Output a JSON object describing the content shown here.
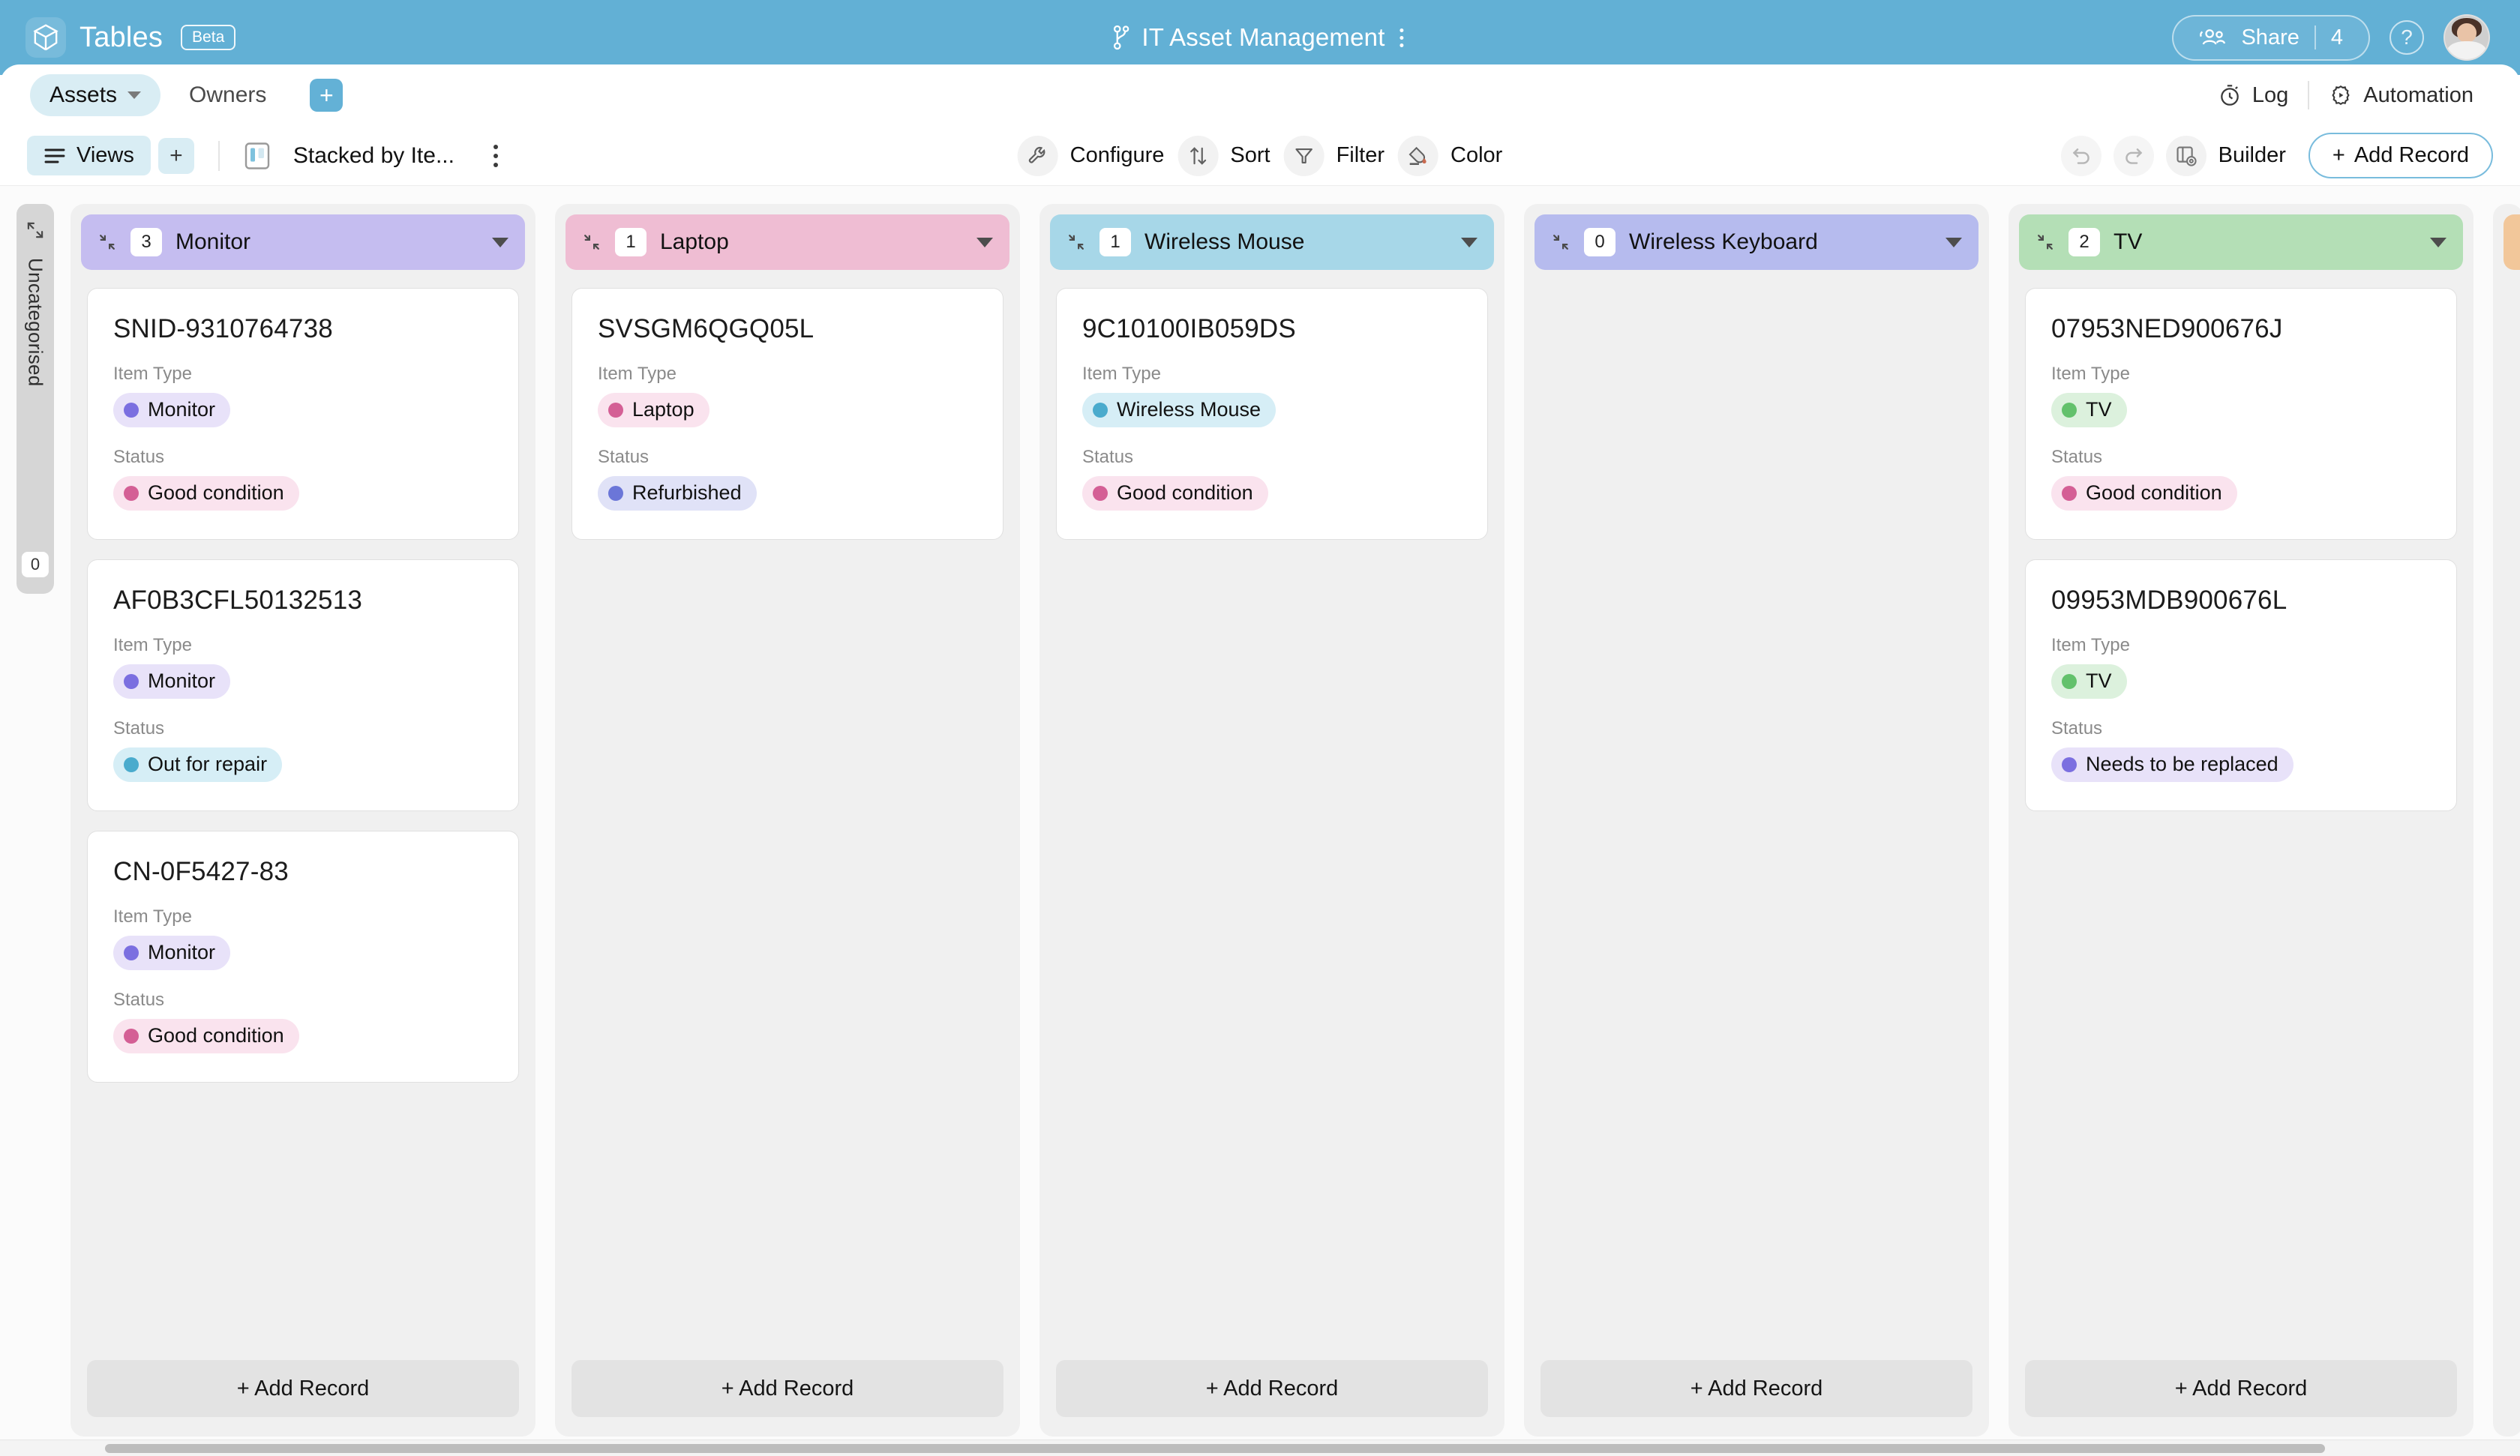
{
  "header": {
    "brand": "Tables",
    "badge": "Beta",
    "logo_icon": "cube-logo-icon",
    "doc_title": "IT Asset Management",
    "doc_icon": "branch-icon",
    "doc_menu_icon": "more-vertical-icon",
    "share_label": "Share",
    "share_count": "4",
    "share_icon": "people-icon",
    "help_icon": "help-circle-icon",
    "help_label": "?",
    "avatar_name": "user-avatar",
    "bg_color": "#62b0d5"
  },
  "tabbar": {
    "tabs": [
      {
        "label": "Assets",
        "active": true,
        "has_caret": true
      },
      {
        "label": "Owners",
        "active": false,
        "has_caret": false
      }
    ],
    "add_tab_label": "+",
    "right_items": [
      {
        "label": "Log",
        "icon": "stopwatch-icon"
      },
      {
        "label": "Automation",
        "icon": "gear-play-icon"
      }
    ]
  },
  "toolbar": {
    "views_label": "Views",
    "views_icon": "list-lines-icon",
    "add_view_label": "+",
    "view_icon": "kanban-board-icon",
    "view_name": "Stacked by Ite...",
    "view_menu_icon": "more-vertical-icon",
    "center_buttons": [
      {
        "label": "Configure",
        "icon": "wrench-icon"
      },
      {
        "label": "Sort",
        "icon": "sort-arrows-icon"
      },
      {
        "label": "Filter",
        "icon": "funnel-icon"
      },
      {
        "label": "Color",
        "icon": "paint-drop-icon"
      }
    ],
    "undo_icon": "undo-icon",
    "redo_icon": "redo-icon",
    "builder_label": "Builder",
    "builder_icon": "builder-panel-icon",
    "add_record_label": "Add Record"
  },
  "board": {
    "collapsed_column": {
      "label": "Uncategorised",
      "count": "0",
      "expand_icon": "expand-icon"
    },
    "add_record_label": "+ Add Record",
    "collapse_icon": "collapse-icon",
    "columns": [
      {
        "title": "Monitor",
        "count": "3",
        "header_color": "#c5bdf0",
        "cards": [
          {
            "title": "SNID-9310764738",
            "fields": [
              {
                "label": "Item Type",
                "value": "Monitor",
                "bg": "#e8e2f9",
                "dot": "#7b6fe0"
              },
              {
                "label": "Status",
                "value": "Good condition",
                "bg": "#fae3ee",
                "dot": "#d45f95"
              }
            ]
          },
          {
            "title": "AF0B3CFL50132513",
            "fields": [
              {
                "label": "Item Type",
                "value": "Monitor",
                "bg": "#e8e2f9",
                "dot": "#7b6fe0"
              },
              {
                "label": "Status",
                "value": "Out for repair",
                "bg": "#d6eef6",
                "dot": "#4aabcd"
              }
            ]
          },
          {
            "title": "CN-0F5427-83",
            "fields": [
              {
                "label": "Item Type",
                "value": "Monitor",
                "bg": "#e8e2f9",
                "dot": "#7b6fe0"
              },
              {
                "label": "Status",
                "value": "Good condition",
                "bg": "#fae3ee",
                "dot": "#d45f95"
              }
            ]
          }
        ]
      },
      {
        "title": "Laptop",
        "count": "1",
        "header_color": "#efbdd3",
        "cards": [
          {
            "title": "SVSGM6QGQ05L",
            "fields": [
              {
                "label": "Item Type",
                "value": "Laptop",
                "bg": "#fae3ee",
                "dot": "#d45f95"
              },
              {
                "label": "Status",
                "value": "Refurbished",
                "bg": "#e0e2f7",
                "dot": "#6b76d8"
              }
            ]
          }
        ]
      },
      {
        "title": "Wireless Mouse",
        "count": "1",
        "header_color": "#a7d7e8",
        "cards": [
          {
            "title": "9C10100IB059DS",
            "fields": [
              {
                "label": "Item Type",
                "value": "Wireless Mouse",
                "bg": "#d6eef6",
                "dot": "#4aabcd"
              },
              {
                "label": "Status",
                "value": "Good condition",
                "bg": "#fae3ee",
                "dot": "#d45f95"
              }
            ]
          }
        ]
      },
      {
        "title": "Wireless Keyboard",
        "count": "0",
        "header_color": "#b6bbee",
        "cards": []
      },
      {
        "title": "TV",
        "count": "2",
        "header_color": "#b4dfb6",
        "cards": [
          {
            "title": "07953NED900676J",
            "fields": [
              {
                "label": "Item Type",
                "value": "TV",
                "bg": "#dcf1dd",
                "dot": "#63c16c"
              },
              {
                "label": "Status",
                "value": "Good condition",
                "bg": "#fae3ee",
                "dot": "#d45f95"
              }
            ]
          },
          {
            "title": "09953MDB900676L",
            "fields": [
              {
                "label": "Item Type",
                "value": "TV",
                "bg": "#dcf1dd",
                "dot": "#63c16c"
              },
              {
                "label": "Status",
                "value": "Needs to be replaced",
                "bg": "#e8e2f9",
                "dot": "#7b6fe0"
              }
            ]
          }
        ]
      },
      {
        "title": "",
        "count": "",
        "header_color": "#f2c79a",
        "partial": true,
        "cards": []
      }
    ]
  }
}
